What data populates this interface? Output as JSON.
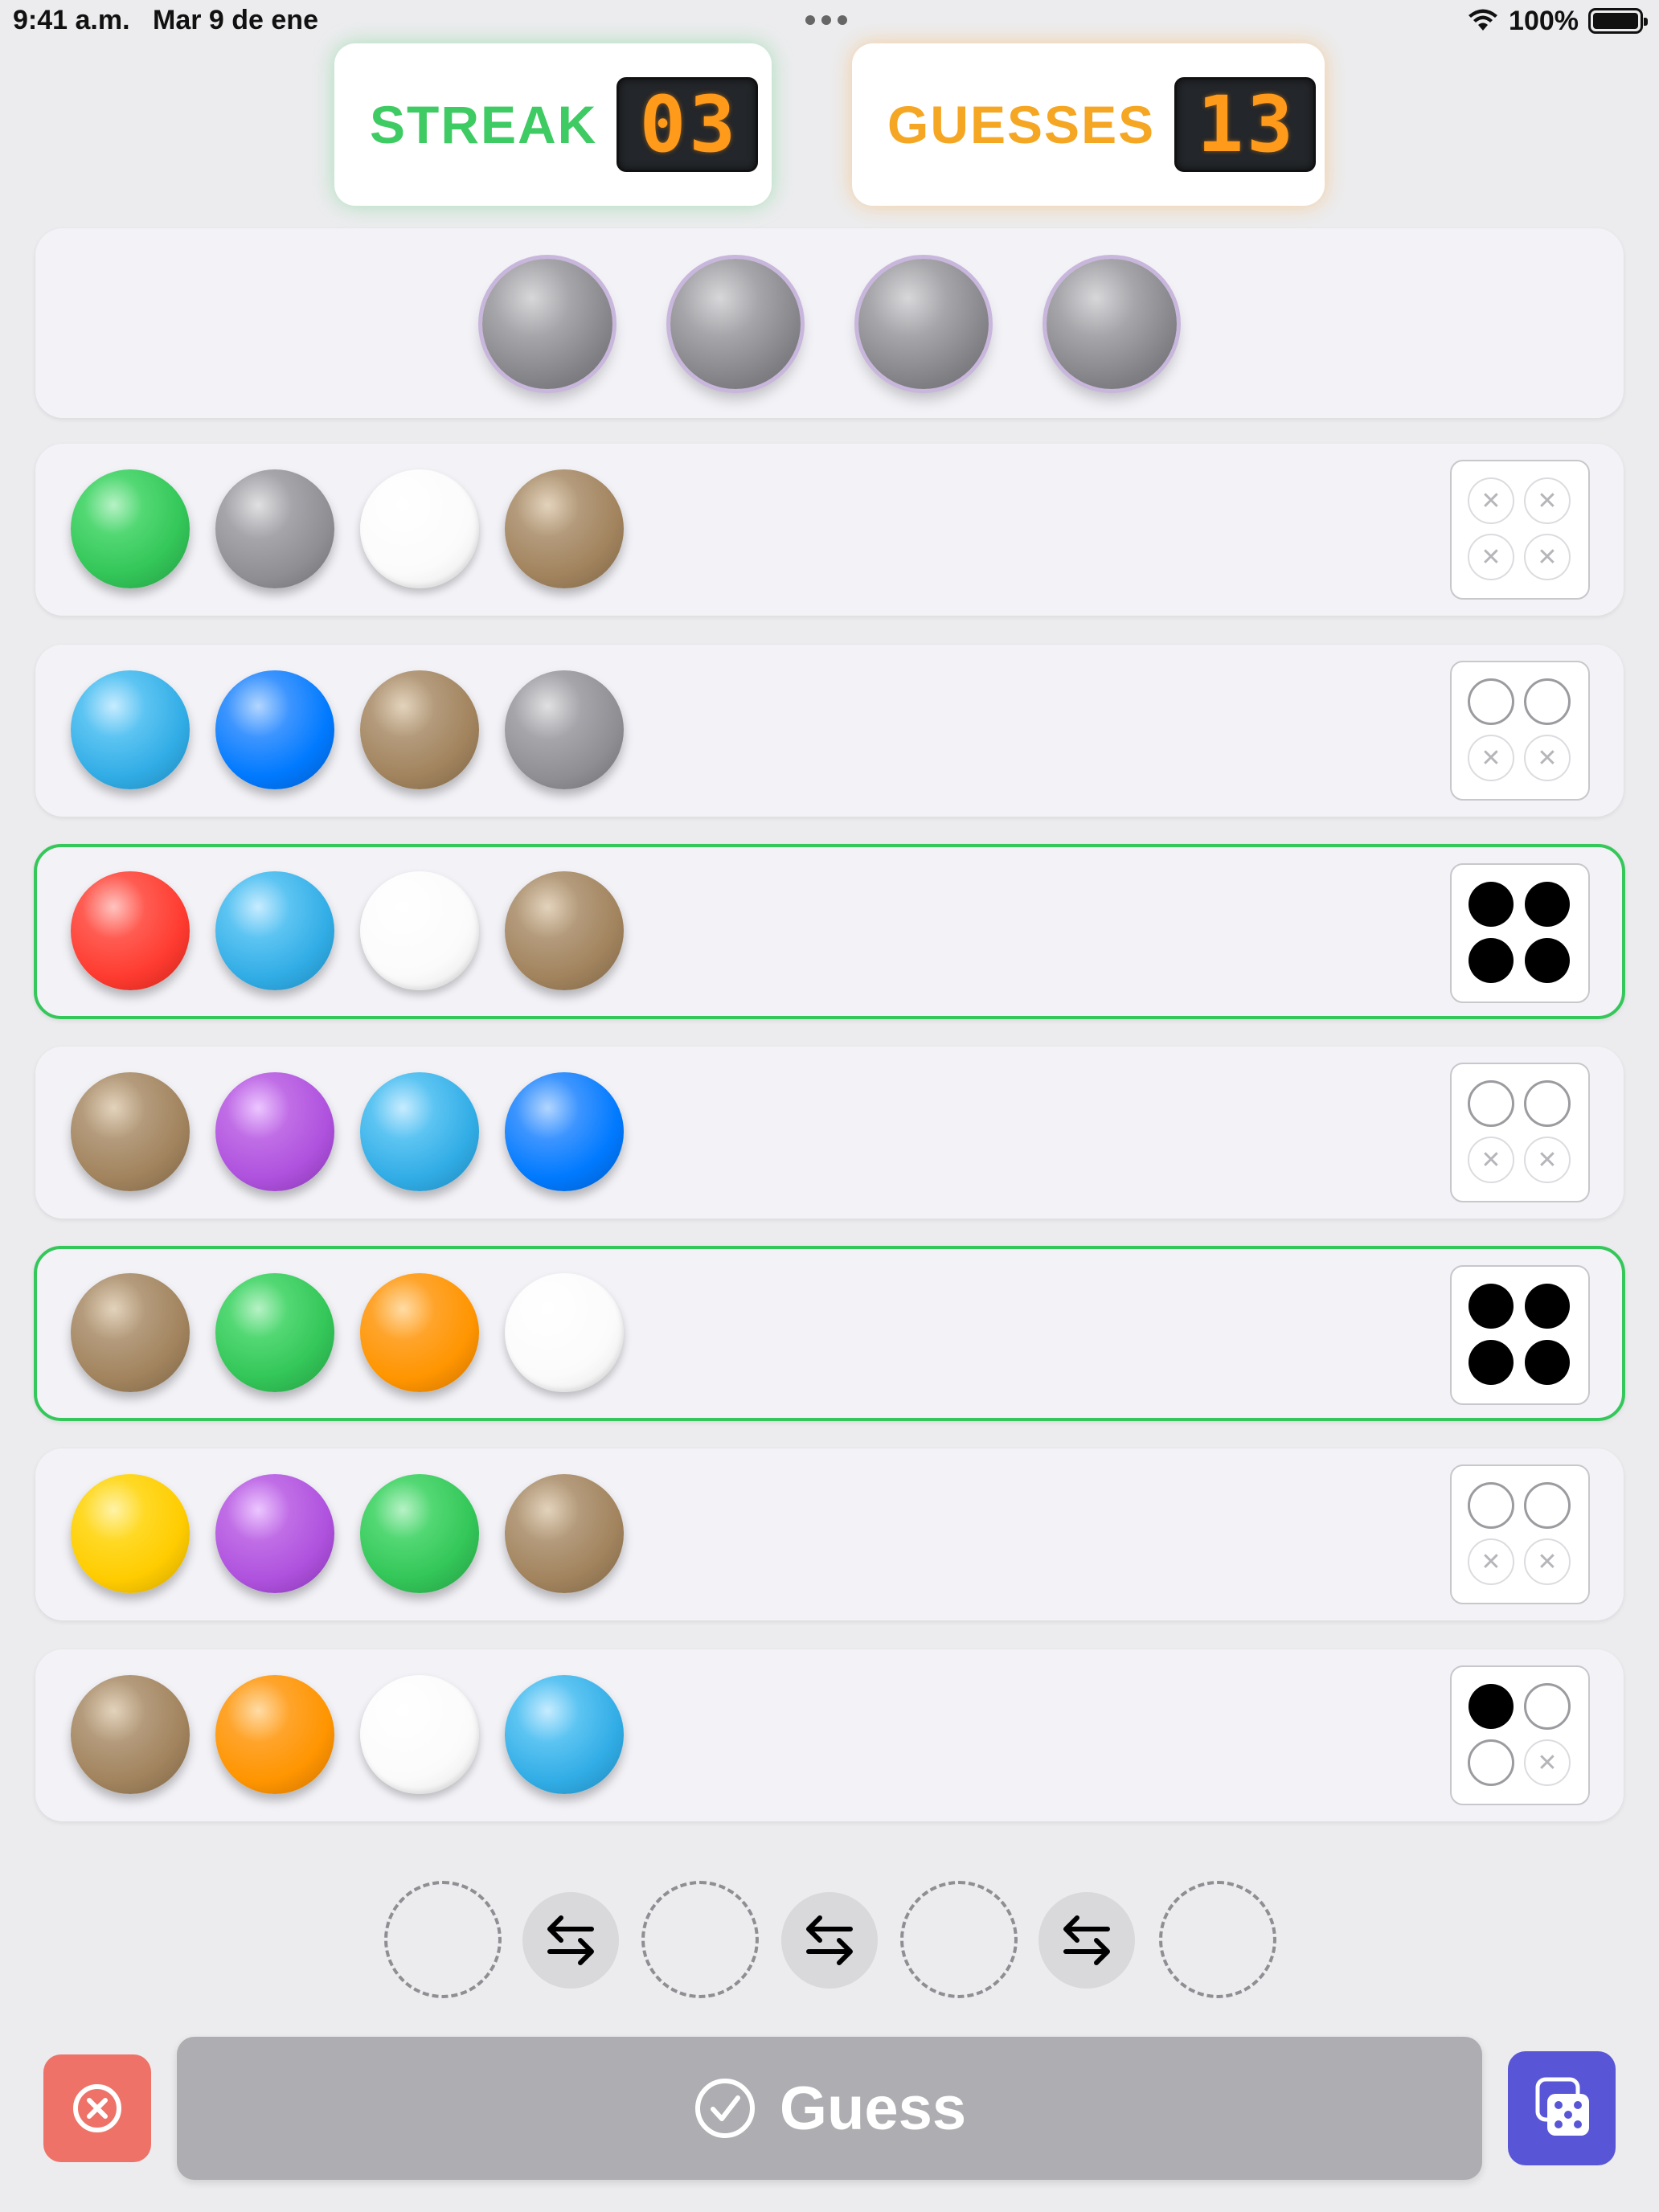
{
  "status_bar": {
    "time": "9:41 a.m.",
    "date": "Mar 9 de ene",
    "battery": "100%"
  },
  "score": {
    "streak_label": "STREAK",
    "streak_digits": [
      "0",
      "3"
    ],
    "guesses_label": "GUESSES",
    "guesses_digits": [
      "1",
      "3"
    ]
  },
  "secret": {
    "hidden_pegs": [
      "gray",
      "gray",
      "gray",
      "gray"
    ]
  },
  "guesses": [
    {
      "pegs": [
        "green",
        "gray",
        "white",
        "brown"
      ],
      "feedback": [
        "miss",
        "miss",
        "miss",
        "miss"
      ],
      "correct": false
    },
    {
      "pegs": [
        "cyan",
        "blue",
        "brown",
        "gray"
      ],
      "feedback": [
        "hollow",
        "hollow",
        "miss",
        "miss"
      ],
      "correct": false
    },
    {
      "pegs": [
        "red",
        "cyan",
        "white",
        "brown"
      ],
      "feedback": [
        "black",
        "black",
        "black",
        "black"
      ],
      "correct": true
    },
    {
      "pegs": [
        "brown",
        "purple",
        "cyan",
        "blue"
      ],
      "feedback": [
        "hollow",
        "hollow",
        "miss",
        "miss"
      ],
      "correct": false
    },
    {
      "pegs": [
        "brown",
        "green",
        "orange",
        "white"
      ],
      "feedback": [
        "black",
        "black",
        "black",
        "black"
      ],
      "correct": true
    },
    {
      "pegs": [
        "yellow",
        "purple",
        "green",
        "brown"
      ],
      "feedback": [
        "hollow",
        "hollow",
        "miss",
        "miss"
      ],
      "correct": false
    },
    {
      "pegs": [
        "brown",
        "orange",
        "white",
        "cyan"
      ],
      "feedback": [
        "black",
        "hollow",
        "hollow",
        "miss"
      ],
      "correct": false
    }
  ],
  "actions": {
    "guess_label": "Guess",
    "clear_icon": "xmark-circle-icon",
    "random_icon": "dice-icon",
    "swap_icon": "arrow-left-right-icon"
  },
  "colors": {
    "green": "#34c759",
    "gray": "#8e8e93",
    "white": "#ffffff",
    "brown": "#a2845e",
    "cyan": "#32ade6",
    "blue": "#007aff",
    "red": "#ff3b30",
    "purple": "#af52de",
    "orange": "#ff9500",
    "yellow": "#ffcc00",
    "correct_border": "#34c759",
    "clear_button": "#ee7268",
    "random_button": "#5856d6",
    "guess_button": "#aeaeb2"
  }
}
